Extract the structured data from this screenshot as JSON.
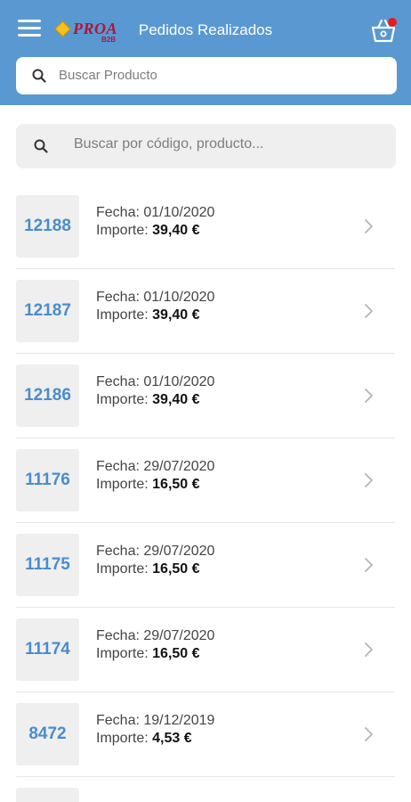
{
  "header": {
    "title": "Pedidos Realizados",
    "logo_text": "PROA",
    "logo_sub": "B2B",
    "menu_icon": "hamburger-icon",
    "cart_icon": "basket-icon",
    "cart_badge_color": "#e51c23",
    "background_color": "#5a98d2"
  },
  "top_search": {
    "placeholder": "Buscar Producto",
    "icon": "search-icon"
  },
  "filter_search": {
    "placeholder": "Buscar por código, producto...",
    "icon": "search-icon"
  },
  "orders": [
    {
      "code": "12188",
      "date_label": "Fecha: ",
      "date": "01/10/2020",
      "amount_label": "Importe: ",
      "amount": "39,40 €"
    },
    {
      "code": "12187",
      "date_label": "Fecha: ",
      "date": "01/10/2020",
      "amount_label": "Importe: ",
      "amount": "39,40 €"
    },
    {
      "code": "12186",
      "date_label": "Fecha: ",
      "date": "01/10/2020",
      "amount_label": "Importe: ",
      "amount": "39,40 €"
    },
    {
      "code": "11176",
      "date_label": "Fecha: ",
      "date": "29/07/2020",
      "amount_label": "Importe: ",
      "amount": "16,50 €"
    },
    {
      "code": "11175",
      "date_label": "Fecha: ",
      "date": "29/07/2020",
      "amount_label": "Importe: ",
      "amount": "16,50 €"
    },
    {
      "code": "11174",
      "date_label": "Fecha: ",
      "date": "29/07/2020",
      "amount_label": "Importe: ",
      "amount": "16,50 €"
    },
    {
      "code": "8472",
      "date_label": "Fecha: ",
      "date": "19/12/2019",
      "amount_label": "Importe: ",
      "amount": "4,53 €"
    }
  ]
}
